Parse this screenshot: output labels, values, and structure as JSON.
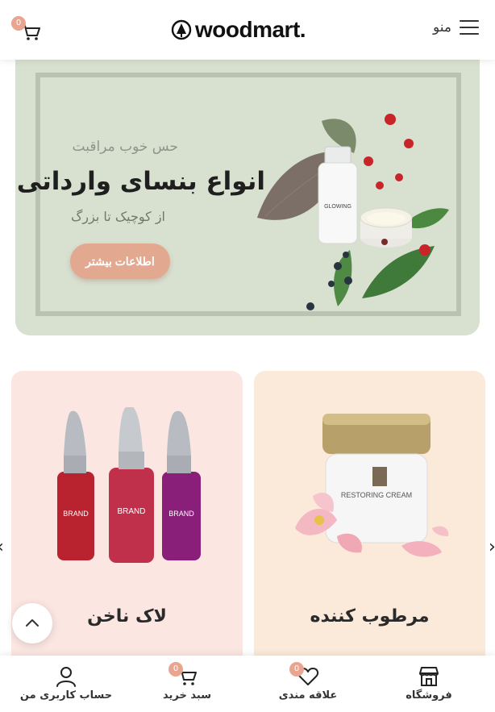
{
  "header": {
    "cart_count": "0",
    "logo_text": "woodmart.",
    "menu_label": "منو"
  },
  "hero": {
    "subtitle": "حس خوب مراقبت",
    "title": "انواع بنسای وارداتی",
    "description": "از کوچیک تا بزرگ",
    "button_label": "اطلاعات بیشتر",
    "bottle_label": "GLOWING"
  },
  "categories": [
    {
      "title": "لاک ناخن",
      "bottle_labels": [
        "BRAND",
        "BRAND",
        "BRAND"
      ]
    },
    {
      "title": "مرطوب کننده",
      "jar_label": "RESTORING CREAM"
    }
  ],
  "bottom_nav": {
    "items": [
      {
        "label": "حساب کاربری من",
        "icon": "user-icon"
      },
      {
        "label": "سبد خرید",
        "icon": "cart-icon",
        "badge": "0"
      },
      {
        "label": "علاقه مندی",
        "icon": "heart-icon",
        "badge": "0"
      },
      {
        "label": "فروشگاه",
        "icon": "shop-icon"
      }
    ]
  },
  "colors": {
    "accent": "#e2a890",
    "hero_bg": "#d8e0d0",
    "card_pink": "#fbe6e2",
    "card_peach": "#fbeada"
  }
}
